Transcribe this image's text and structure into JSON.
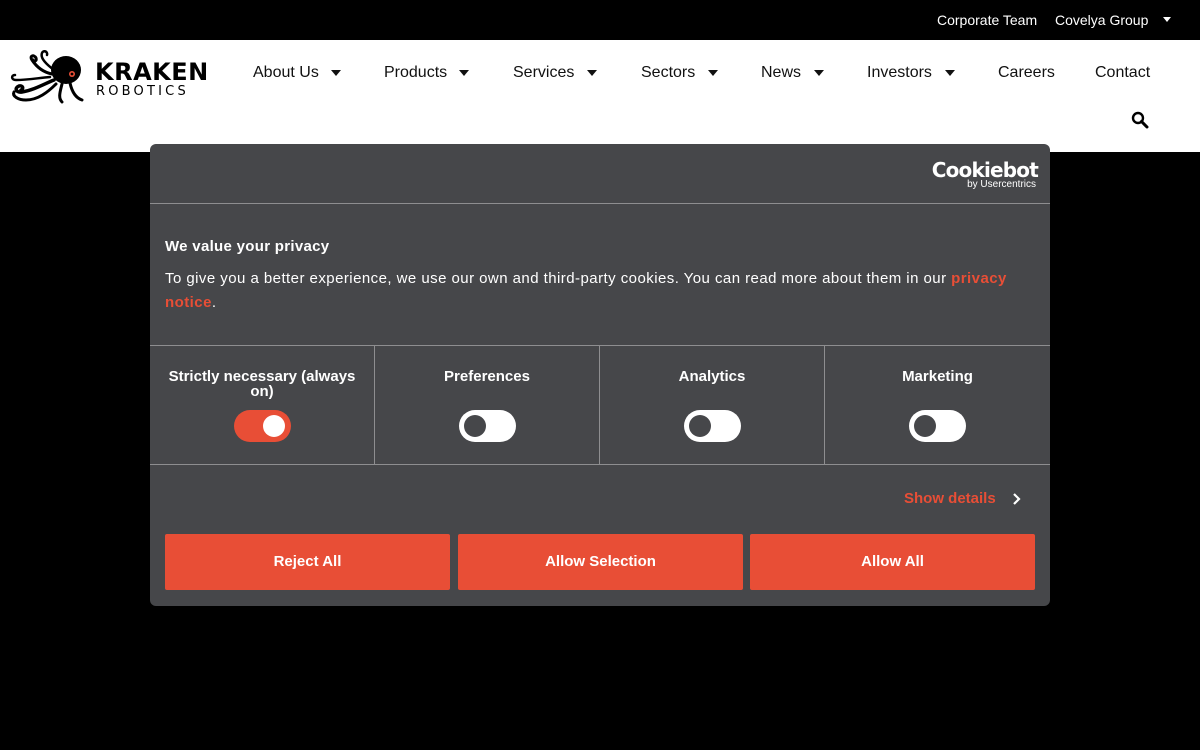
{
  "topbar": {
    "corporate_team": "Corporate Team",
    "group_label": "Covelya Group"
  },
  "logo": {
    "line1": "KRAKEN",
    "line2": "ROBOTICS"
  },
  "nav": {
    "about": "About Us",
    "products": "Products",
    "services": "Services",
    "sectors": "Sectors",
    "news": "News",
    "investors": "Investors",
    "careers": "Careers",
    "contact": "Contact"
  },
  "cookie_dialog": {
    "brand": "Cookiebot",
    "brand_sub": "by Usercentrics",
    "title": "We value your privacy",
    "text": "To give you a better experience, we use our own and third-party cookies. You can read more about them in our ",
    "link_text": "privacy notice",
    "text_end": ".",
    "categories": [
      {
        "label": "Strictly necessary (always on)",
        "enabled": true
      },
      {
        "label": "Preferences",
        "enabled": false
      },
      {
        "label": "Analytics",
        "enabled": false
      },
      {
        "label": "Marketing",
        "enabled": false
      }
    ],
    "show_details": "Show details",
    "buttons": {
      "reject": "Reject All",
      "selection": "Allow Selection",
      "allow_all": "Allow All"
    }
  },
  "colors": {
    "accent": "#e84e36",
    "dialog_bg": "#46474a",
    "page_bg": "#000000",
    "header_bg": "#ffffff"
  },
  "icons": [
    "chevron-down-icon",
    "kraken-octopus-logo",
    "search-icon",
    "chevron-right-icon"
  ]
}
